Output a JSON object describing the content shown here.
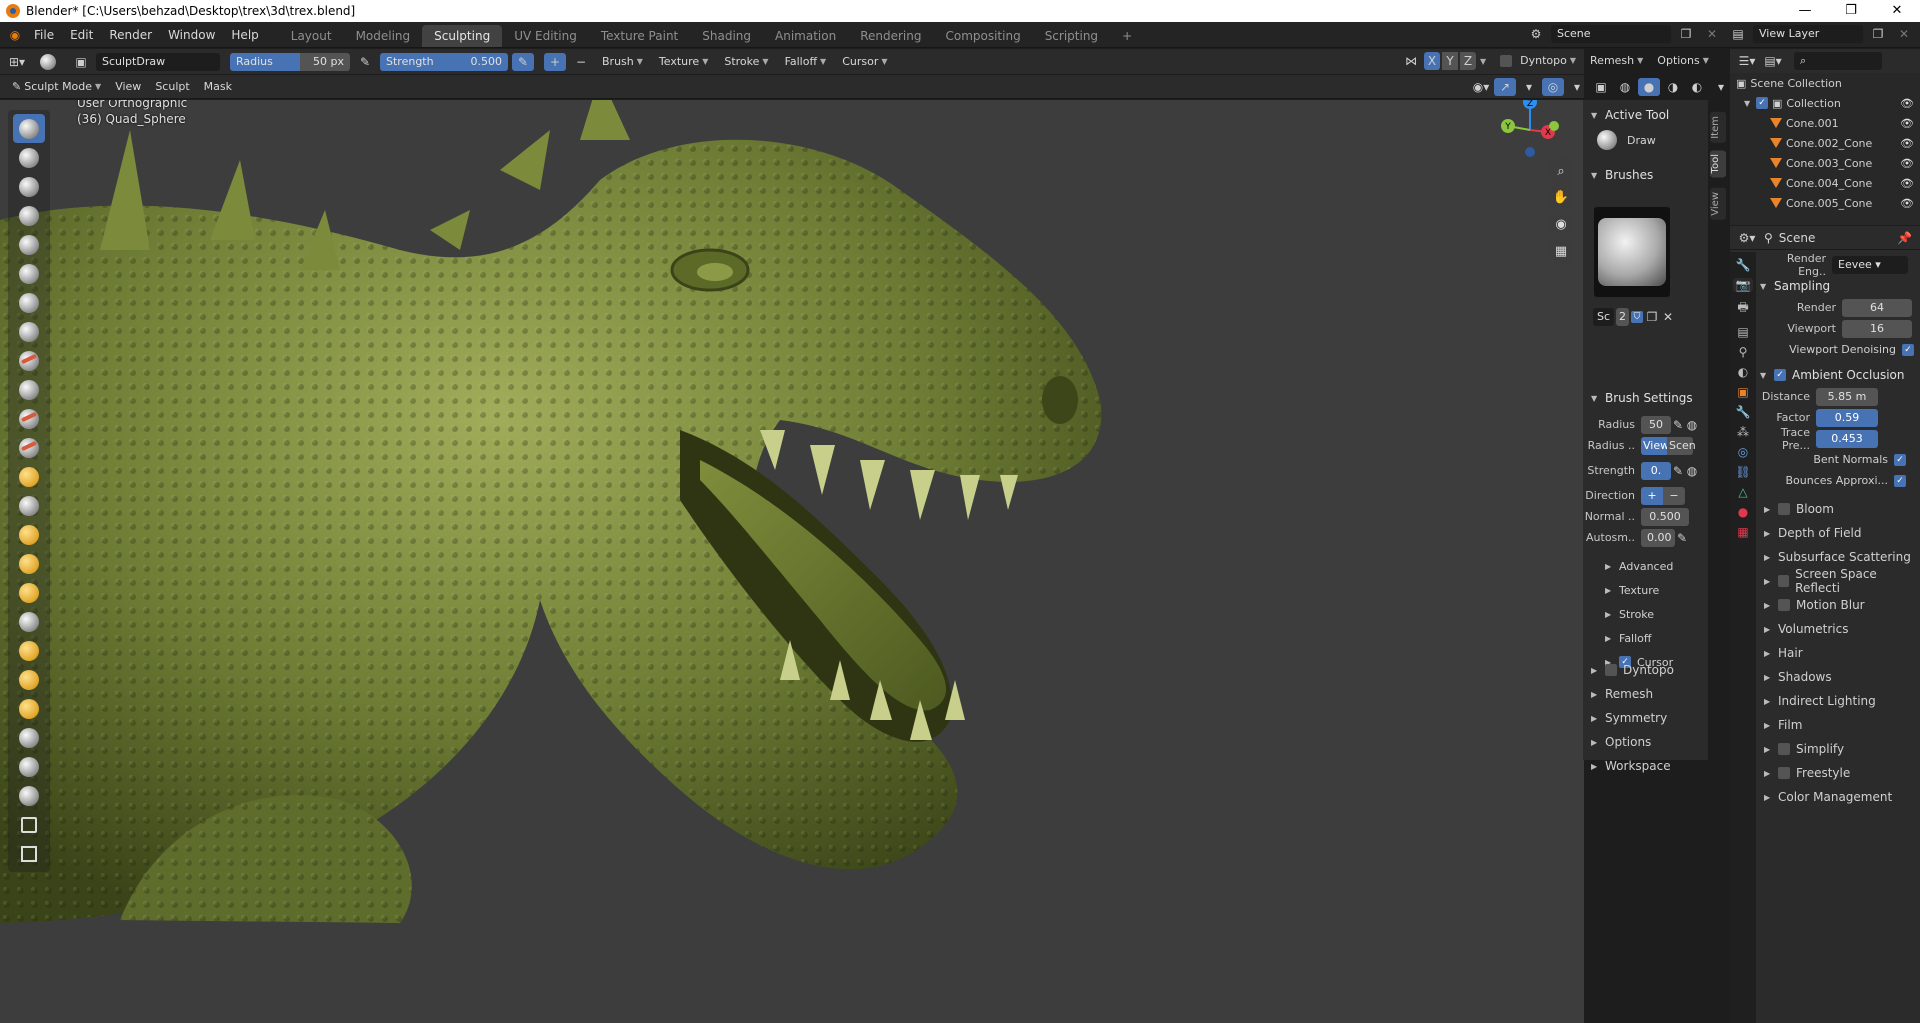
{
  "window": {
    "title": "Blender* [C:\\Users\\behzad\\Desktop\\trex\\3d\\trex.blend]",
    "minimize": "—",
    "restore": "❐",
    "close": "✕"
  },
  "menubar": {
    "items": [
      "File",
      "Edit",
      "Render",
      "Window",
      "Help"
    ],
    "workspaces": [
      "Layout",
      "Modeling",
      "Sculpting",
      "UV Editing",
      "Texture Paint",
      "Shading",
      "Animation",
      "Rendering",
      "Compositing",
      "Scripting"
    ],
    "active_workspace": "Sculpting",
    "add_tab": "+",
    "scene_label": "Scene",
    "view_layer_label": "View Layer"
  },
  "tool_header": {
    "brush_name": "SculptDraw",
    "radius_label": "Radius",
    "radius_value": "50 px",
    "strength_label": "Strength",
    "strength_value": "0.500",
    "plus": "+",
    "minus": "−",
    "menus": [
      "Brush",
      "Texture",
      "Stroke",
      "Falloff",
      "Cursor"
    ],
    "axes": [
      "X",
      "Y",
      "Z"
    ],
    "dyntopo": "Dyntopo",
    "remesh": "Remesh",
    "options": "Options"
  },
  "mode_header": {
    "mode": "Sculpt Mode",
    "menus": [
      "View",
      "Sculpt",
      "Mask"
    ]
  },
  "viewport": {
    "view_name": "User Orthographic",
    "object_info": "(36) Quad_Sphere",
    "gizmo_axes": [
      "X",
      "Y",
      "Z"
    ],
    "colors": {
      "x": "#e0394e",
      "y": "#8cc63e",
      "z": "#2e8ef0",
      "sculpt": "#6e7d35",
      "background": "#3d3d3d"
    }
  },
  "tool_panel": {
    "active_tool_title": "Active Tool",
    "active_tool_name": "Draw",
    "brushes_title": "Brushes",
    "brush_slot_name": "Sc",
    "brush_users": "2",
    "brush_settings_title": "Brush Settings",
    "radius_label": "Radius",
    "radius_value": "50",
    "radius_unit_label": "Radius ..",
    "radius_unit_options": [
      "View",
      "Scen"
    ],
    "strength_label": "Strength",
    "strength_value": "0.",
    "direction_label": "Direction",
    "direction_add": "+",
    "direction_sub": "− S",
    "normal_label": "Normal ..",
    "normal_value": "0.500",
    "autosmooth_label": "Autosm..",
    "autosmooth_value": "0.00",
    "subpanels": [
      "Advanced",
      "Texture",
      "Stroke",
      "Falloff",
      "Cursor"
    ],
    "cursor_checked": true,
    "sections": [
      "Dyntopo",
      "Remesh",
      "Symmetry",
      "Options",
      "Workspace"
    ],
    "side_tabs": [
      "Item",
      "Tool",
      "View"
    ]
  },
  "outliner": {
    "root": "Scene Collection",
    "collection": "Collection",
    "items": [
      "Cone.001",
      "Cone.002_Cone",
      "Cone.003_Cone",
      "Cone.004_Cone",
      "Cone.005_Cone"
    ]
  },
  "properties": {
    "context": "Scene",
    "render_engine_label": "Render Eng..",
    "render_engine_value": "Eevee",
    "sampling_title": "Sampling",
    "render_label": "Render",
    "render_value": "64",
    "viewport_label": "Viewport",
    "viewport_value": "16",
    "viewport_denoising": "Viewport Denoising",
    "ao_title": "Ambient Occlusion",
    "distance_label": "Distance",
    "distance_value": "5.85 m",
    "factor_label": "Factor",
    "factor_value": "0.59",
    "trace_label": "Trace Pre...",
    "trace_value": "0.453",
    "bent_normals": "Bent Normals",
    "bounces_approx": "Bounces Approxi...",
    "panels": [
      {
        "label": "Bloom",
        "checkbox": true
      },
      {
        "label": "Depth of Field",
        "checkbox": false
      },
      {
        "label": "Subsurface Scattering",
        "checkbox": false
      },
      {
        "label": "Screen Space Reflecti",
        "checkbox": true
      },
      {
        "label": "Motion Blur",
        "checkbox": true
      },
      {
        "label": "Volumetrics",
        "checkbox": false
      },
      {
        "label": "Hair",
        "checkbox": false
      },
      {
        "label": "Shadows",
        "checkbox": false
      },
      {
        "label": "Indirect Lighting",
        "checkbox": false
      },
      {
        "label": "Film",
        "checkbox": false
      },
      {
        "label": "Simplify",
        "checkbox": true
      },
      {
        "label": "Freestyle",
        "checkbox": true
      },
      {
        "label": "Color Management",
        "checkbox": false
      }
    ]
  }
}
